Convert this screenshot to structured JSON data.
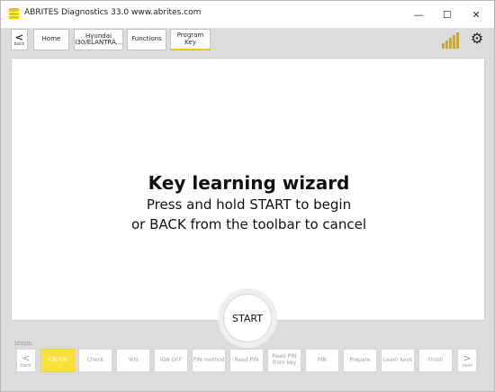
{
  "window": {
    "title": "ABRITES Diagnostics 33.0   www.abrites.com",
    "minimize": "—",
    "maximize": "☐",
    "close": "✕"
  },
  "toolbar": {
    "back_chevron": "<",
    "back_label": "back",
    "home": "Home",
    "vehicle": "Hyundai i30/ELANTRA...",
    "functions": "Functions",
    "program_key": "Program Key",
    "signal_icon": "signal-strength-icon",
    "settings_icon": "gear-icon",
    "settings_glyph": "⚙",
    "accent_color": "#f5c400"
  },
  "wizard": {
    "title": "Key learning wizard",
    "line1": "Press and hold START to begin",
    "line2": "or BACK from the toolbar to cancel",
    "start_button": "START"
  },
  "steps": {
    "label": "steps:",
    "back_chevron": "<",
    "back_label": "back",
    "next_chevron": ">",
    "next_label": "next",
    "items": [
      {
        "label": "IGN ON",
        "active": true
      },
      {
        "label": "Check",
        "active": false
      },
      {
        "label": "VIN",
        "active": false
      },
      {
        "label": "IGN OFF",
        "active": false
      },
      {
        "label": "PIN method",
        "active": false
      },
      {
        "label": "Read PIN",
        "active": false
      },
      {
        "label": "Read PIN from key",
        "active": false
      },
      {
        "label": "PIN",
        "active": false
      },
      {
        "label": "Prepare",
        "active": false
      },
      {
        "label": "Learn keys",
        "active": false
      },
      {
        "label": "Finish",
        "active": false
      }
    ]
  }
}
